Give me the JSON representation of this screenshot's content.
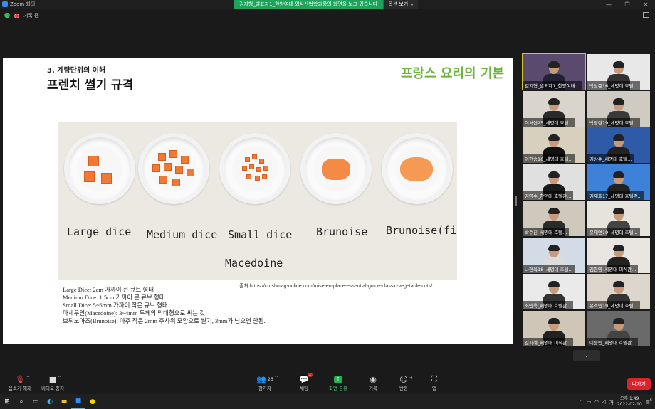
{
  "window": {
    "title": "Zoom 회의"
  },
  "share_banner": {
    "message": "김지형_발표자1_한양여대 외식산업학과장의 화면을 보고 있습니다",
    "options_label": "옵션 보기 ⌄"
  },
  "top_info": {
    "recording_label": "기록 중"
  },
  "slide": {
    "section": "3. 계량단위의 이해",
    "title": "프렌치 썰기 규격",
    "french_title": "프랑스 요리의 기본",
    "photo_labels": [
      "Large dice",
      "Medium dice",
      "Small dice",
      "Brunoise",
      "Brunoise(fine)",
      "Macedoine"
    ],
    "credit": "출처:https://crushmag-online.com/mise-en-place-essential-guide-classic-vegetable-cuts/",
    "notes": [
      "Large Dice: 2cm 가까이 큰 큐브 형태",
      "Medium Dice: 1.5cm 가까이 큰 큐브 형태",
      "Small Dice: 5~6mm 가까이 작은 큐브 형태",
      "마세두안(Macedoine): 3~4mm 두께의 막대형으로 써는 것",
      "브뤼노아즈(Brunoise): 아주 작은 2mm 주사위 모양으로 썰기, 3mm가 넘으면 안됨."
    ]
  },
  "participants": [
    {
      "name": "김지형_발표자1_한양여대...",
      "bg": "#5a4a6e",
      "shirt": "#223",
      "active": true
    },
    {
      "name": "박상준16_세명대 호텔...",
      "bg": "#e8e8e8",
      "shirt": "#333",
      "active": false
    },
    {
      "name": "이서연25_세명대 호텔...",
      "bg": "#d9d4cc",
      "shirt": "#2a2a2a",
      "active": false
    },
    {
      "name": "박경란19_세명대 호텔...",
      "bg": "#cfcac2",
      "shirt": "#3a3a3a",
      "active": false
    },
    {
      "name": "이현승16_세명대 호텔...",
      "bg": "#d8d0bf",
      "shirt": "#111",
      "active": false
    },
    {
      "name": "김상수_세명대 호텔...",
      "bg": "#2f5aa8",
      "shirt": "#222",
      "active": false
    },
    {
      "name": "김영수_한양대 호텔관...",
      "bg": "#e0e0e0",
      "shirt": "#1a1a1a",
      "active": false
    },
    {
      "name": "김재호17_세명대 호텔관...",
      "bg": "#3d82d8",
      "shirt": "#222",
      "active": false
    },
    {
      "name": "박수진_세명대 호텔...",
      "bg": "#cfc8bd",
      "shirt": "#2b2b2b",
      "active": false
    },
    {
      "name": "유재연19_세명대 호텔...",
      "bg": "#e6e2dc",
      "shirt": "#444",
      "active": false
    },
    {
      "name": "나현욱18_세명대 호텔...",
      "bg": "#d3dce6",
      "shirt": "#dcdcdc",
      "active": false
    },
    {
      "name": "김현영_세명대 미식관...",
      "bg": "#e9e5e0",
      "shirt": "#222",
      "active": false
    },
    {
      "name": "최민욱_세명대 호텔관...",
      "bg": "#eaeaea",
      "shirt": "#333",
      "active": false
    },
    {
      "name": "유소민19_세명대 호텔...",
      "bg": "#ddd6cc",
      "shirt": "#333",
      "active": false
    },
    {
      "name": "김지혜_세명대 미식관...",
      "bg": "#cfc6b8",
      "shirt": "#222",
      "active": false
    },
    {
      "name": "이승빈_세명대 호텔관...",
      "bg": "#6a6a6a",
      "shirt": "#444",
      "active": false
    }
  ],
  "toolbar": {
    "mute": "음소거 해제",
    "video": "비디오 중지",
    "participants": "참가자",
    "participants_count": "26",
    "chat": "채팅",
    "chat_badge": "1",
    "share": "화면 공유",
    "record": "기록",
    "reactions": "반응",
    "apps": "앱",
    "leave": "나가기"
  },
  "taskbar": {
    "time": "오후 1:49",
    "date": "2022-02-10",
    "ime": "가",
    "notif_count": "6"
  }
}
